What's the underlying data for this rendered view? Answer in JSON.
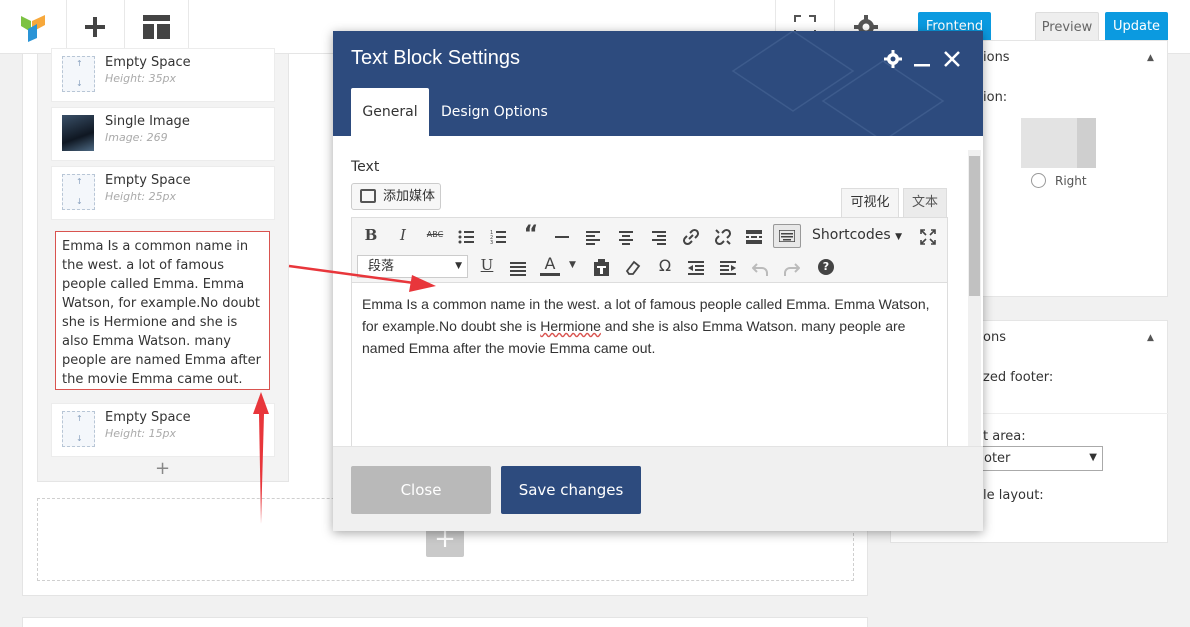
{
  "topbar": {
    "frontend_label": "Frontend",
    "preview_label": "Preview",
    "update_label": "Update"
  },
  "elements": [
    {
      "title": "Empty Space",
      "subtitle": "Height: 35px"
    },
    {
      "title": "Single Image",
      "subtitle": "Image: 269"
    },
    {
      "title": "Empty Space",
      "subtitle": "Height: 25px"
    },
    {
      "title": "Empty Space",
      "subtitle": "Height: 15px"
    }
  ],
  "text_element": {
    "content": "Emma Is a common name in the west. a lot of famous people called Emma. Emma Watson, for example.No doubt she is Hermione and she is also Emma Watson. many people are named Emma after the movie Emma came out."
  },
  "right_panels": {
    "panel1": {
      "title_fragment": "ions",
      "label_fragment": "ion:",
      "option_right": "Right"
    },
    "panel2": {
      "title_fragment": "ons",
      "label1_fragment": "zed footer:",
      "label2_fragment": "t area:",
      "select_fragment": "oter",
      "label3_fragment": "le layout:"
    }
  },
  "modal": {
    "title": "Text Block Settings",
    "tabs": {
      "general": "General",
      "design": "Design Options"
    },
    "field_label": "Text",
    "add_media": "添加媒体",
    "editor_tabs": {
      "visual": "可视化",
      "text": "文本"
    },
    "toolbar": {
      "bold": "B",
      "italic": "I",
      "strike": "ABC",
      "shortcodes": "Shortcodes",
      "paragraph": "段落",
      "underline": "U",
      "text_color": "A",
      "omega": "Ω",
      "help": "?"
    },
    "editor": {
      "before": "Emma Is a common name in the west. a lot of famous people called Emma. Emma Watson, for example.No doubt she is ",
      "misspelled": "Hermione",
      "after": " and she is also Emma Watson. many people are named Emma after the movie Emma came out."
    },
    "close_label": "Close",
    "save_label": "Save changes"
  },
  "colors": {
    "accent": "#0b9ae0",
    "modal_header": "#2d4b7e",
    "highlight": "#d9534f",
    "arrow": "#e8363b"
  },
  "icons": [
    "logo-icon",
    "plus-icon",
    "layout-icon",
    "fullscreen-icon",
    "gear-icon",
    "minimize-icon",
    "close-icon",
    "add-media-icon"
  ]
}
